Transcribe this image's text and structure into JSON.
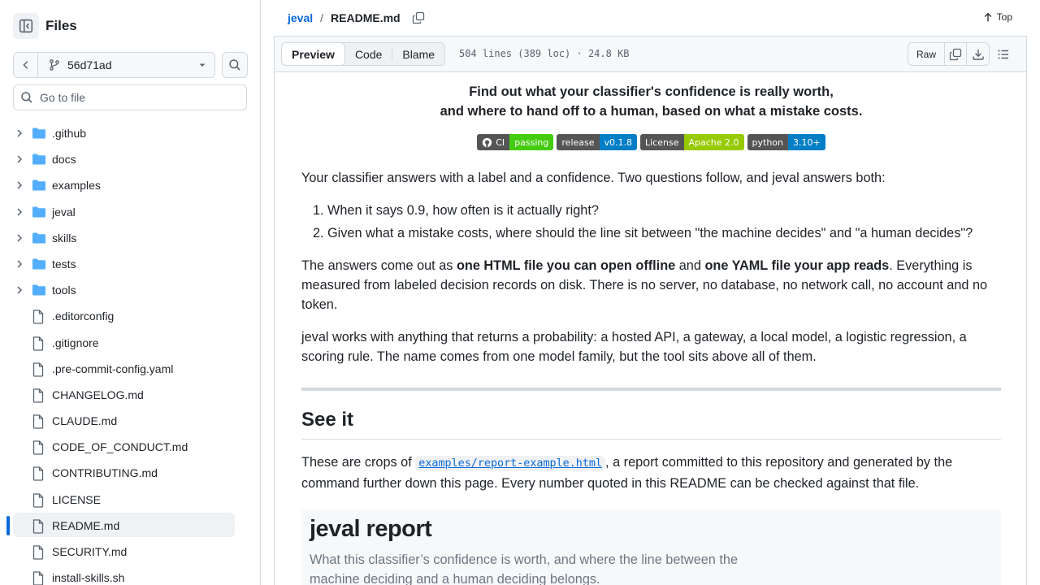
{
  "sidebar": {
    "title": "Files",
    "branch": "56d71ad",
    "goto_placeholder": "Go to file",
    "items": [
      {
        "label": ".github",
        "type": "folder"
      },
      {
        "label": "docs",
        "type": "folder"
      },
      {
        "label": "examples",
        "type": "folder"
      },
      {
        "label": "jeval",
        "type": "folder"
      },
      {
        "label": "skills",
        "type": "folder"
      },
      {
        "label": "tests",
        "type": "folder"
      },
      {
        "label": "tools",
        "type": "folder"
      },
      {
        "label": ".editorconfig",
        "type": "file"
      },
      {
        "label": ".gitignore",
        "type": "file"
      },
      {
        "label": ".pre-commit-config.yaml",
        "type": "file"
      },
      {
        "label": "CHANGELOG.md",
        "type": "file"
      },
      {
        "label": "CLAUDE.md",
        "type": "file"
      },
      {
        "label": "CODE_OF_CONDUCT.md",
        "type": "file"
      },
      {
        "label": "CONTRIBUTING.md",
        "type": "file"
      },
      {
        "label": "LICENSE",
        "type": "file"
      },
      {
        "label": "README.md",
        "type": "file",
        "active": true
      },
      {
        "label": "SECURITY.md",
        "type": "file"
      },
      {
        "label": "install-skills.sh",
        "type": "file"
      }
    ]
  },
  "breadcrumb": {
    "repo": "jeval",
    "sep": "/",
    "file": "README.md"
  },
  "top_link": "Top",
  "filebar": {
    "tabs": [
      "Preview",
      "Code",
      "Blame"
    ],
    "active_tab": "Preview",
    "info": "504 lines (389 loc) · 24.8 KB",
    "raw": "Raw"
  },
  "readme": {
    "tagline_1": "Find out what your classifier's confidence is really worth,",
    "tagline_2": "and where to hand off to a human, based on what a mistake costs.",
    "badges": [
      {
        "left": "CI",
        "right": "passing",
        "color": "#4c1"
      },
      {
        "left": "release",
        "right": "v0.1.8",
        "color": "#007ec6"
      },
      {
        "left": "License",
        "right": "Apache 2.0",
        "color": "#97ca00"
      },
      {
        "left": "python",
        "right": "3.10+",
        "color": "#007ec6"
      }
    ],
    "intro": "Your classifier answers with a label and a confidence. Two questions follow, and jeval answers both:",
    "q1": "When it says 0.9, how often is it actually right?",
    "q2": "Given what a mistake costs, where should the line sit between \"the machine decides\" and \"a human decides\"?",
    "p2_a": "The answers come out as ",
    "p2_b": "one HTML file you can open offline",
    "p2_c": " and ",
    "p2_d": "one YAML file your app reads",
    "p2_e": ". Everything is measured from labeled decision records on disk. There is no server, no database, no network call, no account and no token.",
    "p3": "jeval works with anything that returns a probability: a hosted API, a gateway, a local model, a logistic regression, a scoring rule. The name comes from one model family, but the tool sits above all of them.",
    "h2": "See it",
    "p4_a": "These are crops of ",
    "p4_code": "examples/report-example.html",
    "p4_b": ", a report committed to this repository and generated by the command further down this page. Every number quoted in this README can be checked against that file.",
    "crop_title": "jeval report",
    "crop_sub": "What this classifier’s confidence is worth, and where the line between the machine deciding and a human deciding belongs."
  },
  "colors": {
    "accent": "#0969da",
    "border": "#d1d9e0",
    "folder": "#54aeff"
  }
}
